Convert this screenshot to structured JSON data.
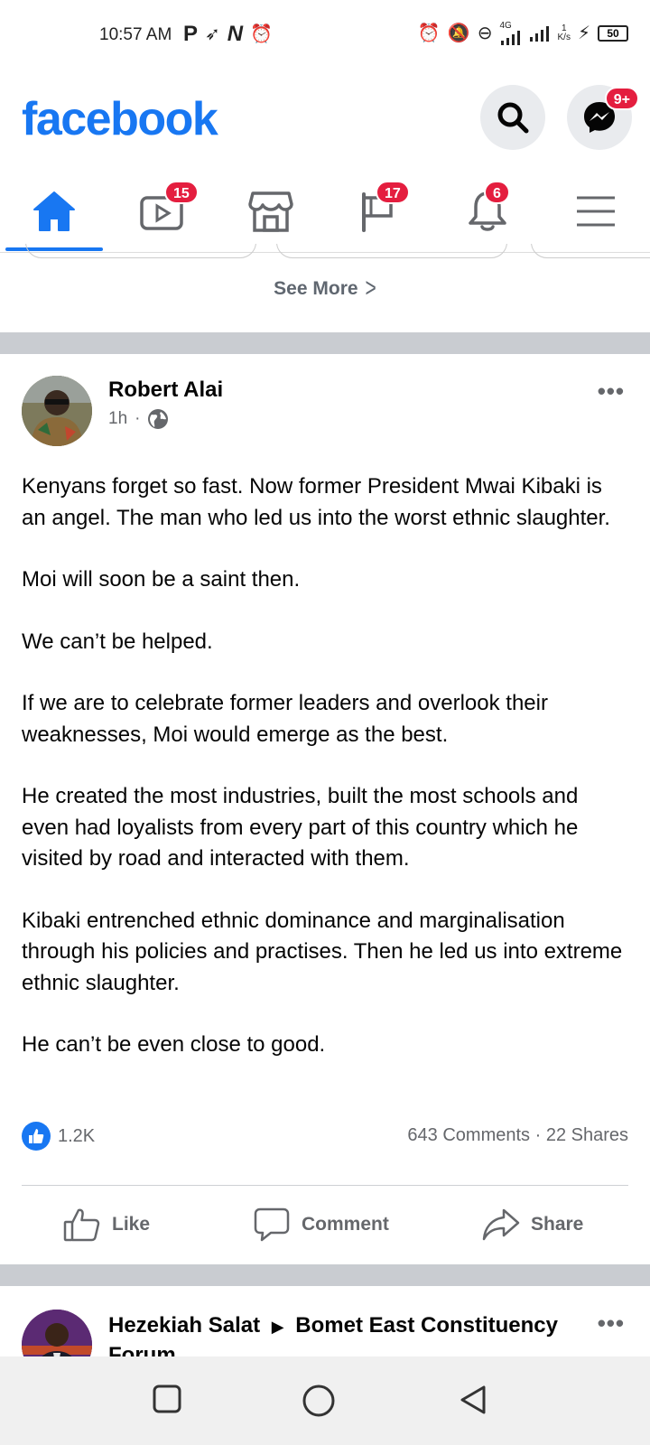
{
  "status_bar": {
    "time": "10:57 AM",
    "network": "4G",
    "speed_value": "1",
    "speed_unit": "K/s",
    "battery": "50"
  },
  "header": {
    "logo": "facebook",
    "messenger_badge": "9+"
  },
  "nav": {
    "tabs": [
      {
        "name": "home",
        "badge": ""
      },
      {
        "name": "watch",
        "badge": "15"
      },
      {
        "name": "marketplace",
        "badge": ""
      },
      {
        "name": "pages",
        "badge": "17"
      },
      {
        "name": "notifications",
        "badge": "6"
      },
      {
        "name": "menu",
        "badge": ""
      }
    ]
  },
  "see_more": "See More",
  "post": {
    "author": "Robert Alai",
    "time": "1h",
    "paragraphs": [
      "Kenyans forget so fast. Now former President Mwai Kibaki is an angel. The man who led us into the worst ethnic slaughter.",
      "Moi will soon be a saint then.",
      "We can’t be helped.",
      "If we are to celebrate former leaders and overlook their weaknesses, Moi would emerge as the best.",
      "He created the most industries, built the most schools and even had loyalists from every part of this country which he visited by road and interacted with them.",
      "Kibaki entrenched ethnic dominance and marginalisation through his policies and practises. Then he led us into extreme ethnic slaughter.",
      "He can’t be even close to good."
    ],
    "reactions_count": "1.2K",
    "comments": "643 Comments",
    "shares": "22 Shares",
    "actions": {
      "like": "Like",
      "comment": "Comment",
      "share": "Share"
    }
  },
  "next_post": {
    "author": "Hezekiah Salat",
    "group": "Bomet East Constituency Forum"
  }
}
